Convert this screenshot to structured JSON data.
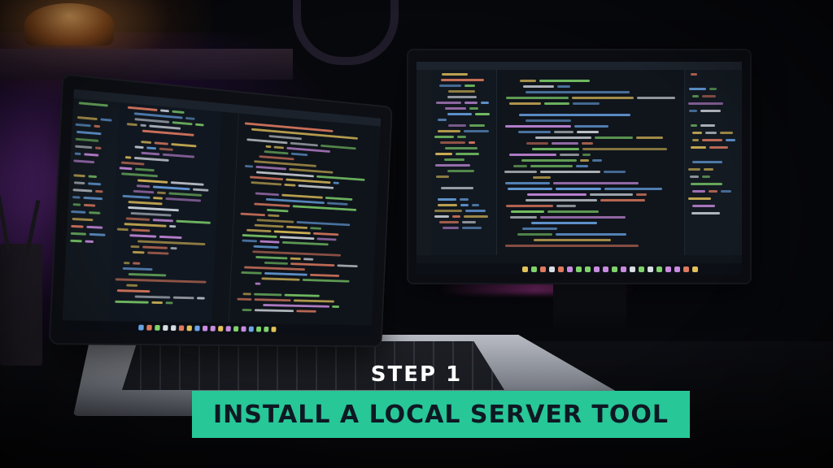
{
  "overlay": {
    "step": "STEP 1",
    "title": "INSTALL A LOCAL SERVER TOOL",
    "banner_color": "#27c798",
    "title_color": "#0e1822",
    "step_color": "#ffffff"
  },
  "scene": {
    "objects": [
      "laptop",
      "monitor",
      "desk-lamp",
      "headphones",
      "pencil-cup"
    ],
    "code_colors": [
      "#7fd36b",
      "#e2c15a",
      "#6aa6e8",
      "#c98be0",
      "#d8dde4",
      "#e07a5f"
    ]
  }
}
